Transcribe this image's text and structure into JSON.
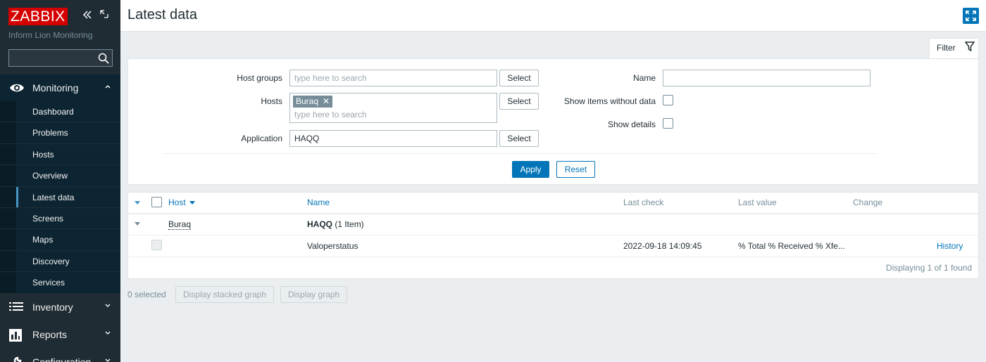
{
  "sidebar": {
    "logo": "ZABBIX",
    "org_name": "Inform Lion Monitoring",
    "search_placeholder": "",
    "menu": {
      "monitoring": "Monitoring",
      "inventory": "Inventory",
      "reports": "Reports",
      "configuration": "Configuration"
    },
    "submenu": [
      "Dashboard",
      "Problems",
      "Hosts",
      "Overview",
      "Latest data",
      "Screens",
      "Maps",
      "Discovery",
      "Services"
    ],
    "active_submenu": "Latest data"
  },
  "header": {
    "title": "Latest data"
  },
  "filter": {
    "tab_label": "Filter",
    "host_groups_label": "Host groups",
    "host_groups_placeholder": "type here to search",
    "hosts_label": "Hosts",
    "hosts_chip": "Buraq",
    "hosts_placeholder": "type here to search",
    "application_label": "Application",
    "application_value": "HAQQ",
    "select_label": "Select",
    "name_label": "Name",
    "name_value": "",
    "show_items_without_data_label": "Show items without data",
    "show_details_label": "Show details",
    "apply_label": "Apply",
    "reset_label": "Reset"
  },
  "table": {
    "columns": {
      "host": "Host",
      "name": "Name",
      "last_check": "Last check",
      "last_value": "Last value",
      "change": "Change"
    },
    "group_row": {
      "host": "Buraq",
      "app_name": "HAQQ",
      "item_count": "(1 Item)"
    },
    "item_row": {
      "name": "Valoperstatus",
      "last_check": "2022-09-18 14:09:45",
      "last_value": "% Total % Received % Xfe...",
      "change": "",
      "history": "History"
    },
    "footer": "Displaying 1 of 1 found"
  },
  "actions": {
    "selected_count": "0 selected",
    "stacked_graph": "Display stacked graph",
    "graph": "Display graph"
  },
  "colors": {
    "sidebar_bg": "#1f2c33",
    "accent": "#0275b8",
    "logo_red": "#d40000"
  }
}
